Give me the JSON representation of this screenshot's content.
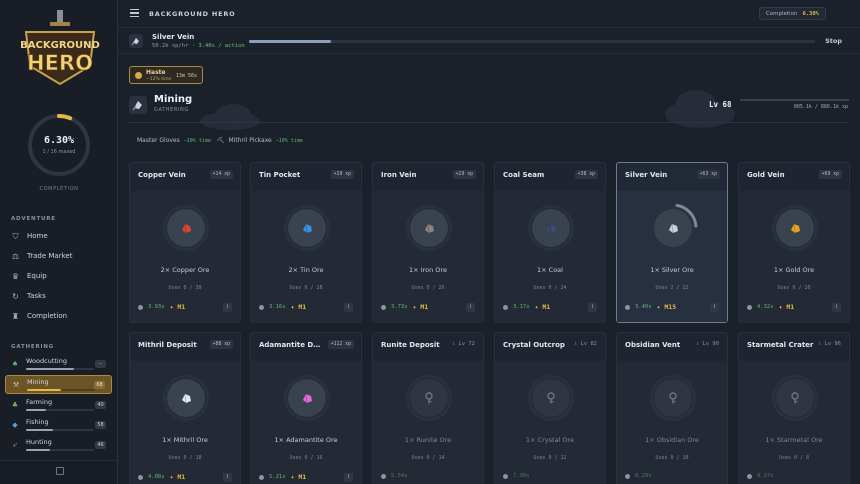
{
  "app": {
    "title": "BACKGROUND HERO",
    "logo_line1": "BACKGROUND",
    "logo_line2": "HERO"
  },
  "completion": {
    "label": "Completion",
    "value": "6.30%",
    "progress": 0.063,
    "subtext": "1 / 16 maxed",
    "caption": "COMPLETION"
  },
  "adventure": {
    "title": "ADVENTURE",
    "items": [
      {
        "label": "Home",
        "icon": "shield-icon"
      },
      {
        "label": "Trade Market",
        "icon": "scale-icon"
      },
      {
        "label": "Equip",
        "icon": "crown-icon"
      },
      {
        "label": "Tasks",
        "icon": "swirl-icon"
      },
      {
        "label": "Completion",
        "icon": "trophy-icon"
      }
    ]
  },
  "gathering": {
    "title": "GATHERING",
    "skills": [
      {
        "label": "Woodcutting",
        "level": "",
        "progress": 0.7,
        "icon": "leaf-icon"
      },
      {
        "label": "Mining",
        "level": "68",
        "progress": 0.5,
        "icon": "pickaxe-icon"
      },
      {
        "label": "Farming",
        "level": "40",
        "progress": 0.3,
        "icon": "sprout-icon"
      },
      {
        "label": "Fishing",
        "level": "58",
        "progress": 0.4,
        "icon": "fish-icon"
      },
      {
        "label": "Hunting",
        "level": "46",
        "progress": 0.35,
        "icon": "bow-icon"
      }
    ]
  },
  "action": {
    "name": "Silver Vein",
    "rate": "50.2k xp/hr · ",
    "speed": "3.40s / action",
    "progress": 0.145,
    "stop_label": "Stop"
  },
  "buff": {
    "name": "Haste",
    "effect": "−12% time",
    "remaining": "13m 56s"
  },
  "skill": {
    "name": "Mining",
    "category": "GATHERING",
    "level": "Lv 68",
    "xp": "805.1k / 880.1k xp"
  },
  "bonuses": [
    {
      "label": "Master Gloves",
      "effect": "−10% time"
    },
    {
      "label": "Mithril Pickaxe",
      "effect": "−10% time"
    }
  ],
  "nodes": [
    {
      "name": "Copper Vein",
      "xp": "+14 xp",
      "produce": "2× Copper Ore",
      "uses": "Uses 0 / 30",
      "time": "3.93s",
      "mastery": "M1",
      "locked": false,
      "ore_color": "#d9472f",
      "active": false
    },
    {
      "name": "Tin Pocket",
      "xp": "+19 xp",
      "produce": "2× Tin Ore",
      "uses": "Uses 0 / 28",
      "time": "3.16s",
      "mastery": "M1",
      "locked": false,
      "ore_color": "#3d8de0",
      "active": false
    },
    {
      "name": "Iron Vein",
      "xp": "+29 xp",
      "produce": "1× Iron Ore",
      "uses": "Uses 0 / 26",
      "time": "3.73s",
      "mastery": "M1",
      "locked": false,
      "ore_color": "#8e8378",
      "active": false
    },
    {
      "name": "Coal Seam",
      "xp": "+38 xp",
      "produce": "1× Coal",
      "uses": "Uses 0 / 24",
      "time": "3.17s",
      "mastery": "M1",
      "locked": false,
      "ore_color": "#3b4a78",
      "active": false
    },
    {
      "name": "Silver Vein",
      "xp": "+63 xp",
      "produce": "1× Silver Ore",
      "uses": "Uses 2 / 22",
      "time": "3.40s",
      "mastery": "M15",
      "locked": false,
      "ore_color": "#c9d2e0",
      "active": true
    },
    {
      "name": "Gold Vein",
      "xp": "+69 xp",
      "produce": "1× Gold Ore",
      "uses": "Uses 0 / 20",
      "time": "4.32s",
      "mastery": "M1",
      "locked": false,
      "ore_color": "#e6a21e",
      "active": false
    },
    {
      "name": "Mithril Deposit",
      "xp": "+88 xp",
      "produce": "1× Mithril Ore",
      "uses": "Uses 0 / 18",
      "time": "4.08s",
      "mastery": "M1",
      "locked": false,
      "ore_color": "#dfe7f2",
      "active": false
    },
    {
      "name": "Adamantite D…",
      "xp": "+112 xp",
      "produce": "1× Adamantite Ore",
      "uses": "Uses 0 / 16",
      "time": "5.21s",
      "mastery": "M1",
      "locked": false,
      "ore_color": "#e06bd6",
      "active": false
    },
    {
      "name": "Runite Deposit",
      "lock_level": "Lv 72",
      "produce": "1× Runite Ore",
      "uses": "Uses 0 / 14",
      "time": "5.54s",
      "locked": true,
      "active": false
    },
    {
      "name": "Crystal Outcrop",
      "lock_level": "Lv 82",
      "produce": "1× Crystal Ore",
      "uses": "Uses 0 / 12",
      "time": "7.30s",
      "locked": true,
      "active": false
    },
    {
      "name": "Obsidian Vent",
      "lock_level": "Lv 90",
      "produce": "1× Obsidian Ore",
      "uses": "Uses 0 / 10",
      "time": "8.29s",
      "locked": true,
      "active": false
    },
    {
      "name": "Starmetal Crater",
      "lock_level": "Lv 96",
      "produce": "1× Starmetal Ore",
      "uses": "Uses 0 / 8",
      "time": "9.27s",
      "locked": true,
      "active": false
    }
  ],
  "colors": {
    "accent": "#e3b949",
    "positive": "#5fb871",
    "active_skill": "#6b5425"
  }
}
